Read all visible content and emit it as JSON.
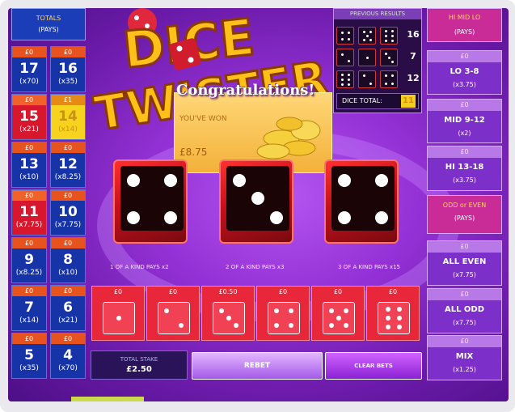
{
  "totals": {
    "title": "TOTALS",
    "pays": "(PAYS)",
    "cells": [
      {
        "stake": "£0",
        "num": "17",
        "pay": "(x70)"
      },
      {
        "stake": "£0",
        "num": "16",
        "pay": "(x35)"
      },
      {
        "stake": "£0",
        "num": "15",
        "pay": "(x21)"
      },
      {
        "stake": "£1",
        "num": "14",
        "pay": "(x14)"
      },
      {
        "stake": "£0",
        "num": "13",
        "pay": "(x10)"
      },
      {
        "stake": "£0",
        "num": "12",
        "pay": "(x8.25)"
      },
      {
        "stake": "£0",
        "num": "11",
        "pay": "(x7.75)"
      },
      {
        "stake": "£0",
        "num": "10",
        "pay": "(x7.75)"
      },
      {
        "stake": "£0",
        "num": "9",
        "pay": "(x8.25)"
      },
      {
        "stake": "£0",
        "num": "8",
        "pay": "(x10)"
      },
      {
        "stake": "£0",
        "num": "7",
        "pay": "(x14)"
      },
      {
        "stake": "£0",
        "num": "6",
        "pay": "(x21)"
      },
      {
        "stake": "£0",
        "num": "5",
        "pay": "(x35)"
      },
      {
        "stake": "£0",
        "num": "4",
        "pay": "(x70)"
      }
    ]
  },
  "logo": {
    "line1": "DICE",
    "line2": "TWISTER"
  },
  "previous": {
    "title": "PREVIOUS RESULTS",
    "totals": [
      "16",
      "7",
      "12"
    ],
    "dice_total_label": "DICE TOTAL:",
    "dice_total": "11"
  },
  "popup": {
    "title": "Congratulations!",
    "you_won": "YOU'VE WON",
    "amount": "£8.75"
  },
  "notes": {
    "one": "1 OF A KIND PAYS x2",
    "two": "2 OF A KIND PAYS x3",
    "three": "3 OF A KIND PAYS x15"
  },
  "bets": [
    {
      "stake": "£0"
    },
    {
      "stake": "£0"
    },
    {
      "stake": "£0.50"
    },
    {
      "stake": "£0"
    },
    {
      "stake": "£0"
    },
    {
      "stake": "£0"
    }
  ],
  "right": {
    "himidlo": {
      "title": "HI MID LO",
      "pays": "(PAYS)"
    },
    "lo": {
      "stake": "£0",
      "label": "LO 3-8",
      "pay": "(x3.75)"
    },
    "mid": {
      "stake": "£0",
      "label": "MID 9-12",
      "pay": "(x2)"
    },
    "hi": {
      "stake": "£0",
      "label": "HI 13-18",
      "pay": "(x3.75)"
    },
    "oddeven": {
      "title": "ODD or EVEN",
      "pays": "(PAYS)"
    },
    "alleven": {
      "stake": "£0",
      "label": "ALL EVEN",
      "pay": "(x7.75)"
    },
    "allodd": {
      "stake": "£0",
      "label": "ALL ODD",
      "pay": "(x7.75)"
    },
    "mix": {
      "stake": "£0",
      "label": "MIX",
      "pay": "(x1.25)"
    }
  },
  "bottom": {
    "total_stake_label": "TOTAL STAKE",
    "total_stake": "£2.50",
    "rebet": "REBET",
    "clear": "CLEAR BETS"
  }
}
